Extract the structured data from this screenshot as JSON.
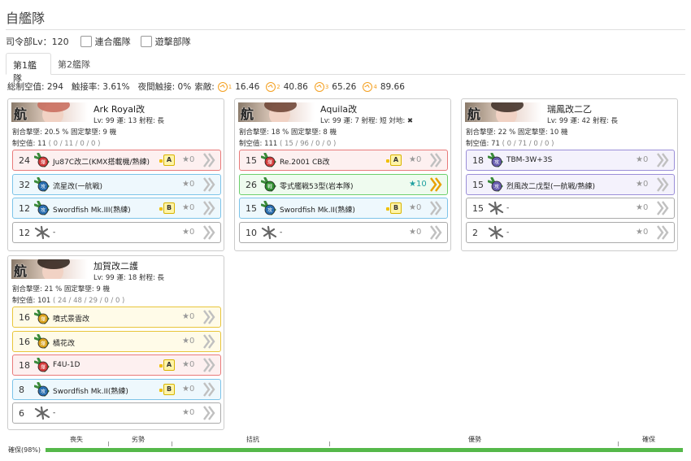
{
  "title": "自艦隊",
  "hq": {
    "label": "司令部Lv：120",
    "combined": "連合艦隊",
    "striking": "遊擊部隊"
  },
  "tabs": [
    "第1艦隊",
    "第2艦隊"
  ],
  "stats": {
    "air": "総制空值: 294",
    "contact": "触接率: 3.61%",
    "night": "夜間触接: 0%",
    "search_label": "索敵:",
    "s1": {
      "sub": "1",
      "val": "16.46"
    },
    "s2": {
      "sub": "2",
      "val": "40.86"
    },
    "s3": {
      "sub": "3",
      "val": "65.26"
    },
    "s4": {
      "sub": "4",
      "val": "89.66"
    }
  },
  "icon_colors": {
    "red": "#e87a7a",
    "blue": "#7cc3e8",
    "green": "#6ccf6c",
    "yellow": "#e8c53a",
    "purple": "#9b8fd8",
    "gray": "#aaaaaa"
  },
  "ships": [
    {
      "name": "Ark Royal改",
      "info": "Lv: 99  運: 13  射程: 長",
      "line1": "割合撃墜: 20.5 %  固定撃墜: 9 機",
      "line2a": "制空值: 11",
      "line2b": "( 0 / 11 / 0 / 0 )",
      "slots": [
        {
          "count": "24",
          "name": "Ju87C改二(KMX搭載機/熟練)",
          "prof": "A",
          "star": "★0",
          "color": "red",
          "icon": "bomber"
        },
        {
          "count": "32",
          "name": "流星改(一航戦)",
          "prof": "",
          "star": "★0",
          "color": "blue",
          "icon": "torp"
        },
        {
          "count": "12",
          "name": "Swordfish Mk.III(熟練)",
          "prof": "B",
          "star": "★0",
          "color": "blue",
          "icon": "torp"
        },
        {
          "count": "12",
          "name": "-",
          "prof": "",
          "star": "★0",
          "color": "gray",
          "icon": "empty"
        }
      ]
    },
    {
      "name": "Aquila改",
      "info": "Lv: 99  運: 7  射程: 短  対地: ✖",
      "line1": "割合撃墜: 18 %  固定撃墜: 8 機",
      "line2a": "制空值: 111",
      "line2b": "( 15 / 96 / 0 / 0 )",
      "slots": [
        {
          "count": "15",
          "name": "Re.2001 CB改",
          "prof": "A",
          "star": "★0",
          "color": "red",
          "icon": "bomber"
        },
        {
          "count": "26",
          "name": "零式艦戦53型(岩本隊)",
          "prof": "",
          "star": "★10",
          "color": "green",
          "icon": "fighter"
        },
        {
          "count": "15",
          "name": "Swordfish Mk.II(熟練)",
          "prof": "B",
          "star": "★0",
          "color": "blue",
          "icon": "torp"
        },
        {
          "count": "10",
          "name": "-",
          "prof": "",
          "star": "★0",
          "color": "gray",
          "icon": "empty"
        }
      ]
    },
    {
      "name": "瑞鳳改二乙",
      "info": "Lv: 99  運: 42  射程: 長",
      "line1": "割合撃墜: 22 %  固定撃墜: 10 機",
      "line2a": "制空值: 71",
      "line2b": "( 0 / 71 / 0 / 0 )",
      "slots": [
        {
          "count": "18",
          "name": "TBM-3W+3S",
          "prof": "",
          "star": "★0",
          "color": "purple",
          "icon": "asw"
        },
        {
          "count": "15",
          "name": "烈風改二戊型(一航戦/熟練)",
          "prof": "",
          "star": "★0",
          "color": "purple",
          "icon": "asw"
        },
        {
          "count": "15",
          "name": "-",
          "prof": "",
          "star": "★0",
          "color": "gray",
          "icon": "empty"
        },
        {
          "count": "2",
          "name": "-",
          "prof": "",
          "star": "★0",
          "color": "gray",
          "icon": "empty"
        }
      ]
    },
    {
      "name": "加賀改二護",
      "info": "Lv: 99  運: 18  射程: 長",
      "line1": "割合撃墜: 21 %  固定撃墜: 9 機",
      "line2a": "制空值: 101",
      "line2b": "( 24 / 48 / 29 / 0 / 0 )",
      "slots": [
        {
          "count": "16",
          "name": "噴式景雲改",
          "prof": "",
          "star": "★0",
          "color": "yellow",
          "icon": "jet"
        },
        {
          "count": "16",
          "name": "橘花改",
          "prof": "",
          "star": "★0",
          "color": "yellow",
          "icon": "jet"
        },
        {
          "count": "18",
          "name": "F4U-1D",
          "prof": "A",
          "star": "★0",
          "color": "red",
          "icon": "bomber"
        },
        {
          "count": "8",
          "name": "Swordfish Mk.II(熟練)",
          "prof": "B",
          "star": "★0",
          "color": "blue",
          "icon": "torp"
        },
        {
          "count": "6",
          "name": "-",
          "prof": "",
          "star": "★0",
          "color": "gray",
          "icon": "empty"
        }
      ]
    }
  ],
  "air_state": {
    "labels": [
      "喪失",
      "劣勢",
      "拮抗",
      "優勢",
      "確保"
    ],
    "current": "確保(98%)",
    "percent": 98
  }
}
